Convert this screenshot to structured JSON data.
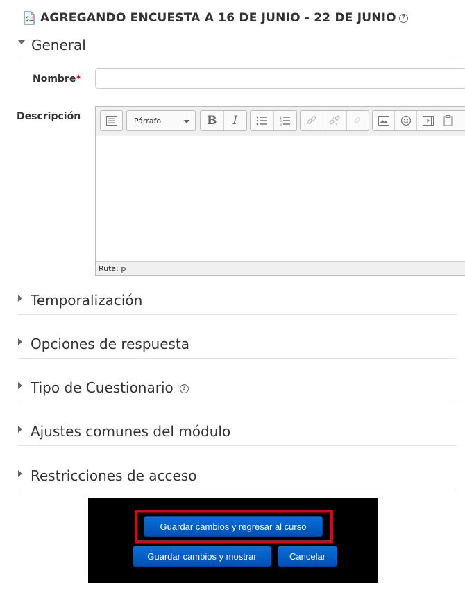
{
  "header": {
    "title": "AGREGANDO ENCUESTA A 16 DE JUNIO - 22 DE JUNIO",
    "help_symbol": "?"
  },
  "sections": {
    "general": "General",
    "temporalizacion": "Temporalización",
    "opciones": "Opciones de respuesta",
    "tipo": "Tipo de Cuestionario",
    "ajustes": "Ajustes comunes del módulo",
    "restricciones": "Restricciones de acceso"
  },
  "form": {
    "nombre_label": "Nombre",
    "required_mark": "*",
    "nombre_value": "",
    "descripcion_label": "Descripción"
  },
  "editor": {
    "format_value": "Párrafo",
    "bold_label": "B",
    "italic_label": "I",
    "status_path": "Ruta: p",
    "toolbar_icons": [
      "toolbar-toggle-icon",
      "bold-icon",
      "italic-icon",
      "bullet-list-icon",
      "numbered-list-icon",
      "link-icon",
      "unlink-icon",
      "anchor-icon",
      "image-icon",
      "emoticon-icon",
      "media-icon",
      "paste-icon"
    ]
  },
  "buttons": {
    "save_return": "Guardar cambios y regresar al curso",
    "save_show": "Guardar cambios y mostrar",
    "cancel": "Cancelar"
  },
  "colors": {
    "button_blue": "#0a6fd6",
    "highlight_red": "#e0001b",
    "panel_bg": "#000000"
  }
}
